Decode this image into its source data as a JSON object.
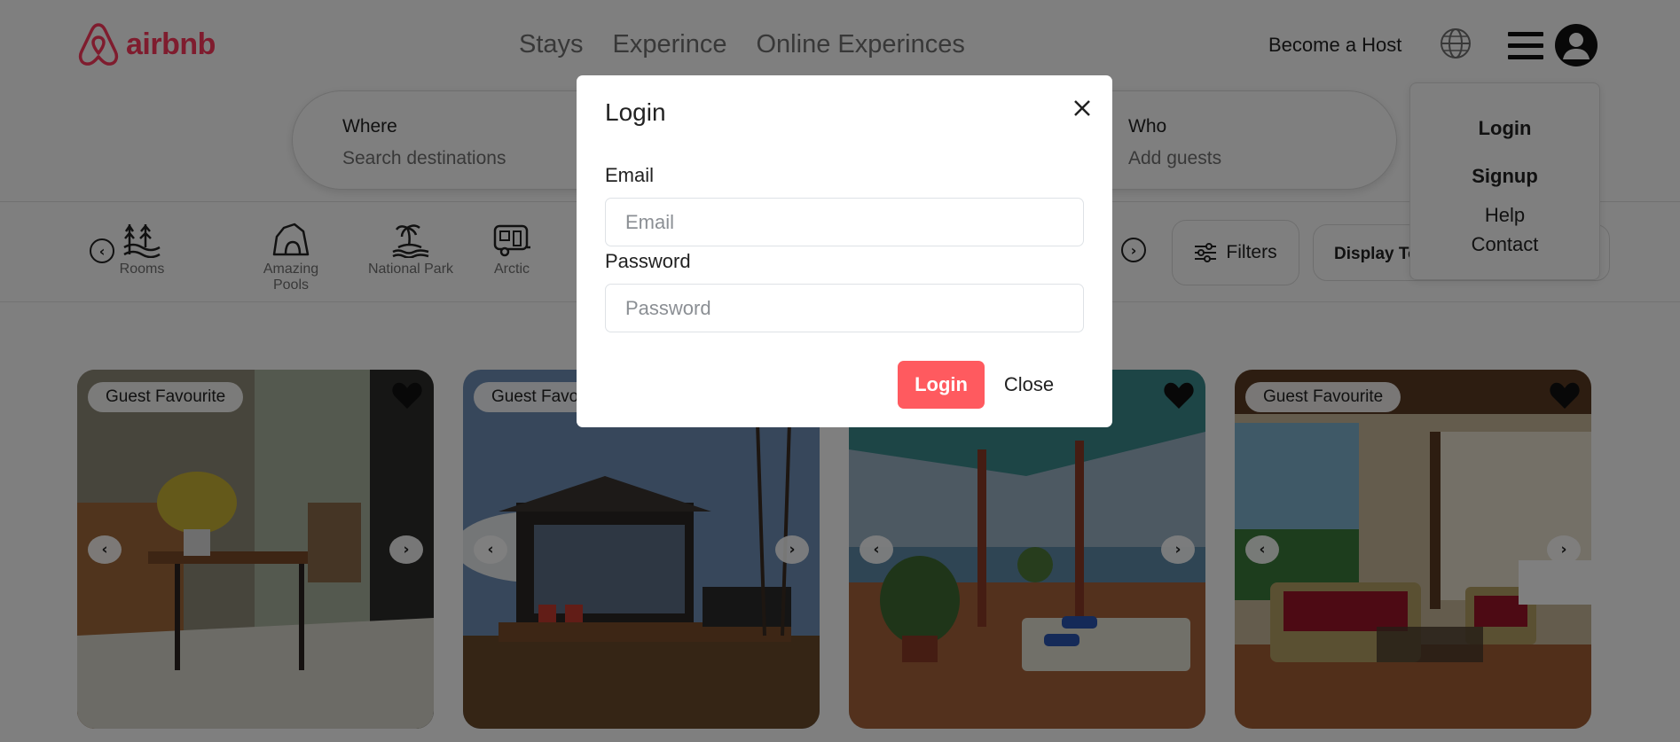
{
  "header": {
    "brand": "airbnb",
    "brand_color": "#FF385C",
    "nav": [
      "Stays",
      "Experince",
      "Online Experinces"
    ],
    "host_link": "Become a Host"
  },
  "search": {
    "where_label": "Where",
    "where_placeholder": "Search destinations",
    "who_label": "Who",
    "who_placeholder": "Add guests"
  },
  "categories": [
    {
      "label": "Rooms",
      "icon": "trees-icon"
    },
    {
      "label": "Amazing Pools",
      "icon": "cave-icon"
    },
    {
      "label": "National Park",
      "icon": "island-icon"
    },
    {
      "label": "Arctic",
      "icon": "camper-icon"
    }
  ],
  "filters_label": "Filters",
  "display_label": "Display To",
  "dropdown": {
    "items": [
      "Login",
      "Signup",
      "Help",
      "Contact"
    ]
  },
  "listings": [
    {
      "badge": "Guest Favourite"
    },
    {
      "badge": "Guest Favourite"
    },
    {
      "badge": ""
    },
    {
      "badge": "Guest Favourite"
    }
  ],
  "modal": {
    "title": "Login",
    "email_label": "Email",
    "email_placeholder": "Email",
    "password_label": "Password",
    "password_placeholder": "Password",
    "login_button": "Login",
    "close_button": "Close",
    "login_color": "#FF5A5F"
  }
}
